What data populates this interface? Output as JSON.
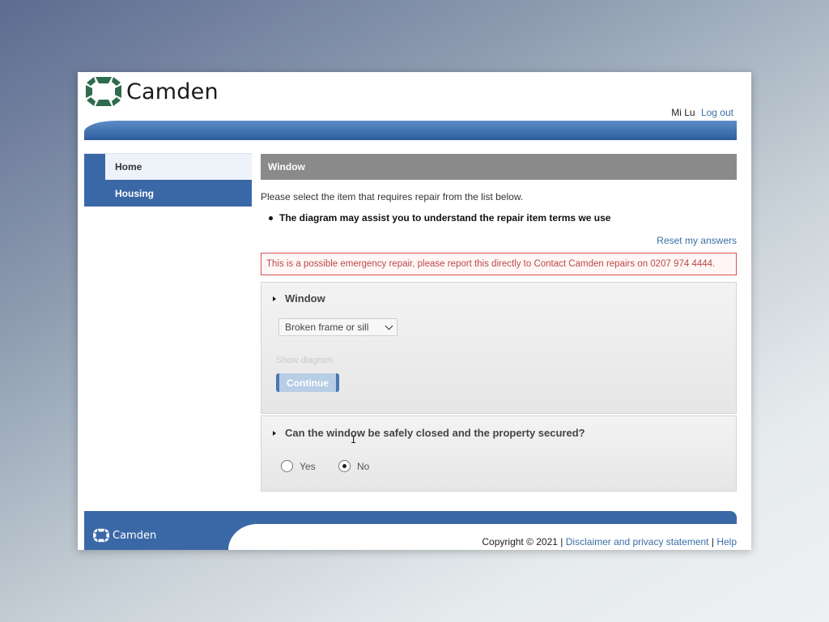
{
  "brand": {
    "name": "Camden",
    "logo_color": "#2f6b4f"
  },
  "user": {
    "name": "Mi Lu",
    "logout_label": "Log out"
  },
  "sidebar": {
    "items": [
      {
        "label": "Home"
      },
      {
        "label": "Housing"
      }
    ]
  },
  "main": {
    "title": "Window",
    "intro": "Please select the item that requires repair from the list below.",
    "bullet": "The diagram may assist you to understand the repair item terms we use",
    "reset_label": "Reset my answers",
    "alert": "This is a possible emergency repair, please report this directly to Contact Camden repairs on 0207 974 4444."
  },
  "panel_window": {
    "heading": "Window",
    "select_value": "Broken frame or sill",
    "show_diagram_label": "Show diagram",
    "continue_label": "Continue"
  },
  "panel_question": {
    "heading": "Can the window be safely closed and the property secured?",
    "options": [
      {
        "label": "Yes",
        "checked": false
      },
      {
        "label": "No",
        "checked": true
      }
    ]
  },
  "footer": {
    "brand": "Camden",
    "copyright": "Copyright © 2021",
    "sep": "|",
    "links": [
      {
        "label": "Disclaimer and privacy statement"
      },
      {
        "label": "Help"
      }
    ]
  },
  "colors": {
    "primary_blue": "#3a68a6",
    "alert_red": "#b94a48",
    "link_blue": "#3a6ea5"
  }
}
